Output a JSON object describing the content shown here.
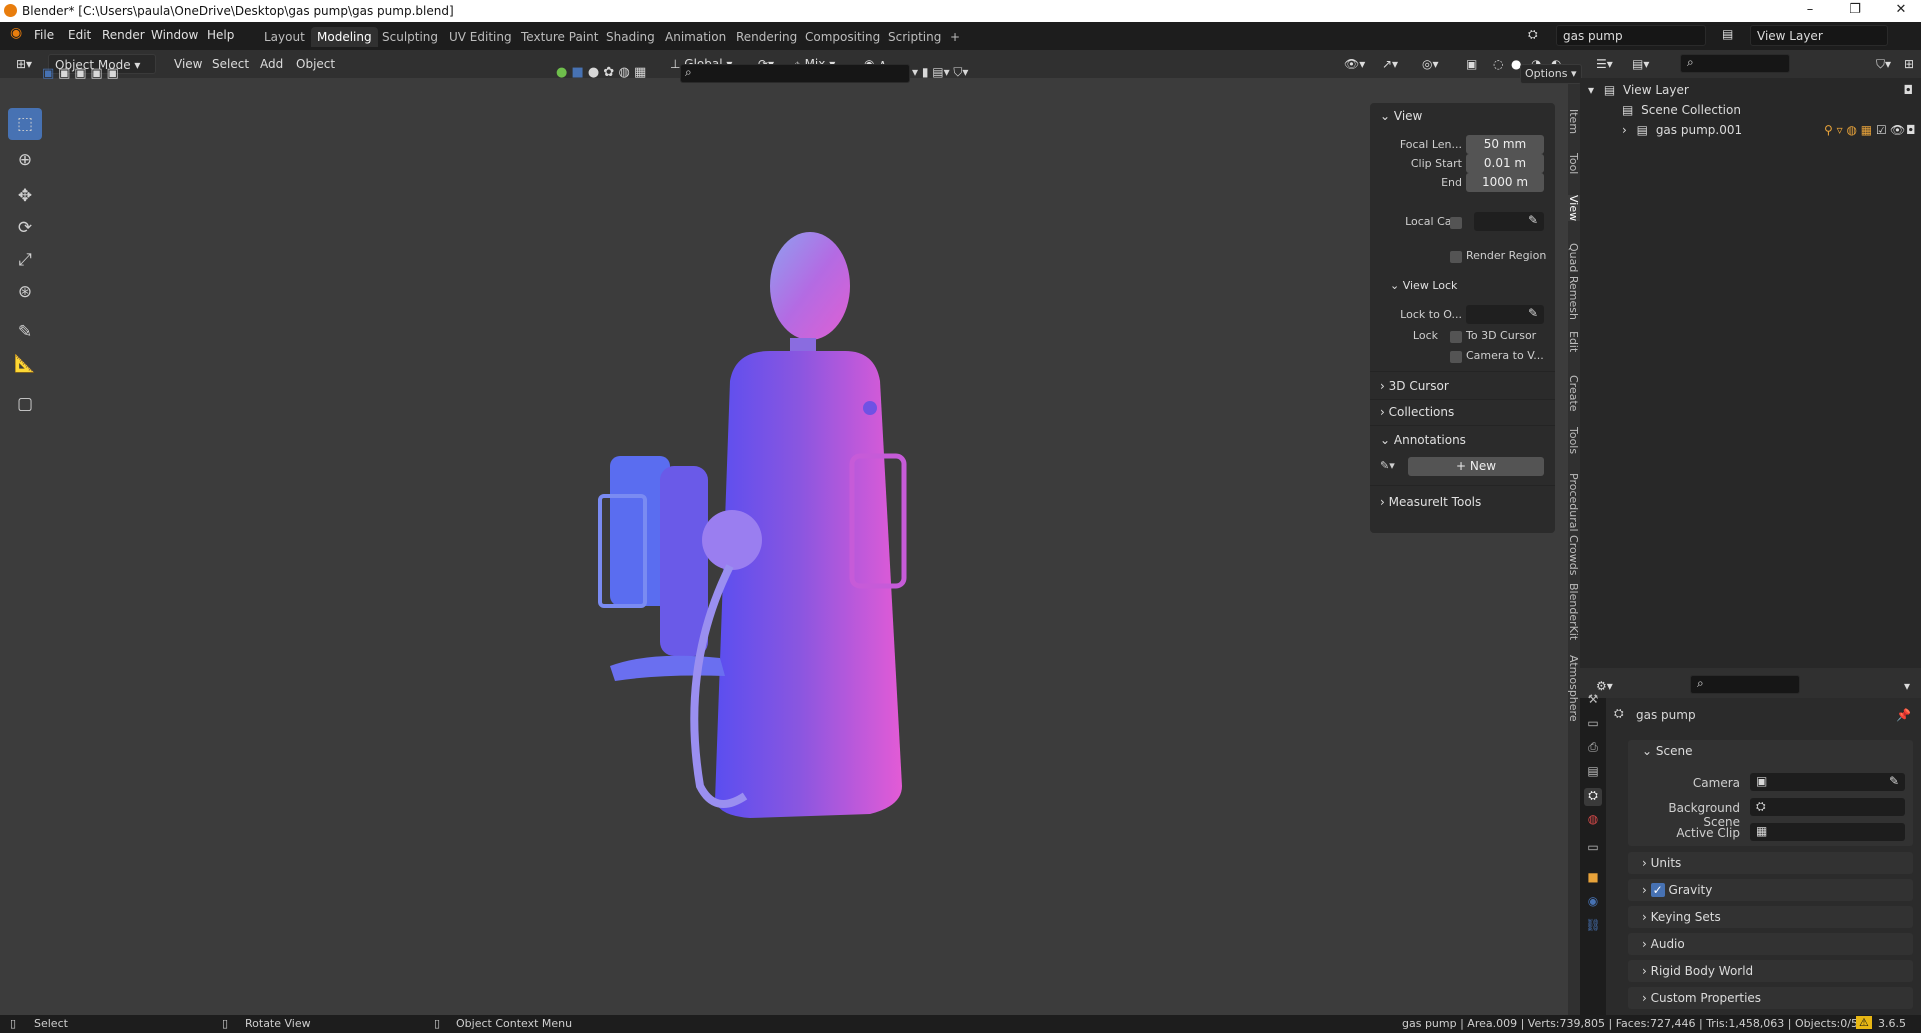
{
  "window": {
    "title": "Blender* [C:\\Users\\paula\\OneDrive\\Desktop\\gas pump\\gas pump.blend]",
    "minimize": "–",
    "maximize": "❐",
    "close": "✕"
  },
  "menubar": {
    "items": [
      "File",
      "Edit",
      "Render",
      "Window",
      "Help"
    ]
  },
  "workspaces": {
    "tabs": [
      "Layout",
      "Modeling",
      "Sculpting",
      "UV Editing",
      "Texture Paint",
      "Shading",
      "Animation",
      "Rendering",
      "Compositing",
      "Scripting"
    ],
    "active": "Modeling",
    "add": "+"
  },
  "scene_selector": {
    "value": "gas pump"
  },
  "view_layer_selector": {
    "value": "View Layer"
  },
  "viewport_header": {
    "mode": "Object Mode",
    "menus": [
      "View",
      "Select",
      "Add",
      "Object"
    ],
    "orientation": "Global",
    "snap_mode": "Mix",
    "options_label": "Options"
  },
  "n_panel": {
    "tabs": [
      "Item",
      "Tool",
      "View",
      "Quad Remesh",
      "Edit",
      "Create",
      "Tools",
      "Procedural Crowds",
      "BlenderKit",
      "Atmosphere"
    ],
    "active_tab": "View",
    "view_header": "View",
    "focal_length_label": "Focal Len...",
    "focal_length_value": "50 mm",
    "clip_start_label": "Clip Start",
    "clip_start_value": "0.01 m",
    "clip_end_label": "End",
    "clip_end_value": "1000 m",
    "local_camera_label": "Local Ca...",
    "render_region_label": "Render Region",
    "view_lock_header": "View Lock",
    "lock_to_object_label": "Lock to O...",
    "lock_label": "Lock",
    "to_3d_cursor_label": "To 3D Cursor",
    "camera_to_view_label": "Camera to V...",
    "cursor_header": "3D Cursor",
    "collections_header": "Collections",
    "annotations_header": "Annotations",
    "new_button": "New",
    "measureit_header": "MeasureIt Tools"
  },
  "outliner": {
    "view_layer": "View Layer",
    "scene_collection": "Scene Collection",
    "object": "gas pump.001"
  },
  "properties": {
    "scene_name": "gas pump",
    "scene_header": "Scene",
    "camera_label": "Camera",
    "background_scene_label": "Background Scene",
    "active_clip_label": "Active Clip",
    "gravity_checked": true,
    "panels": [
      "Units",
      "Gravity",
      "Keying Sets",
      "Audio",
      "Rigid Body World",
      "Custom Properties"
    ]
  },
  "statusbar": {
    "select": "Select",
    "rotate": "Rotate View",
    "context": "Object Context Menu",
    "stats": "gas pump | Area.009 | Verts:739,805 | Faces:727,446 | Tris:1,458,063 | Objects:0/50",
    "version": "3.6.5"
  },
  "colors": {
    "accent": "#4772b3",
    "warning": "#e8b714",
    "brand": "#e87d0d"
  }
}
